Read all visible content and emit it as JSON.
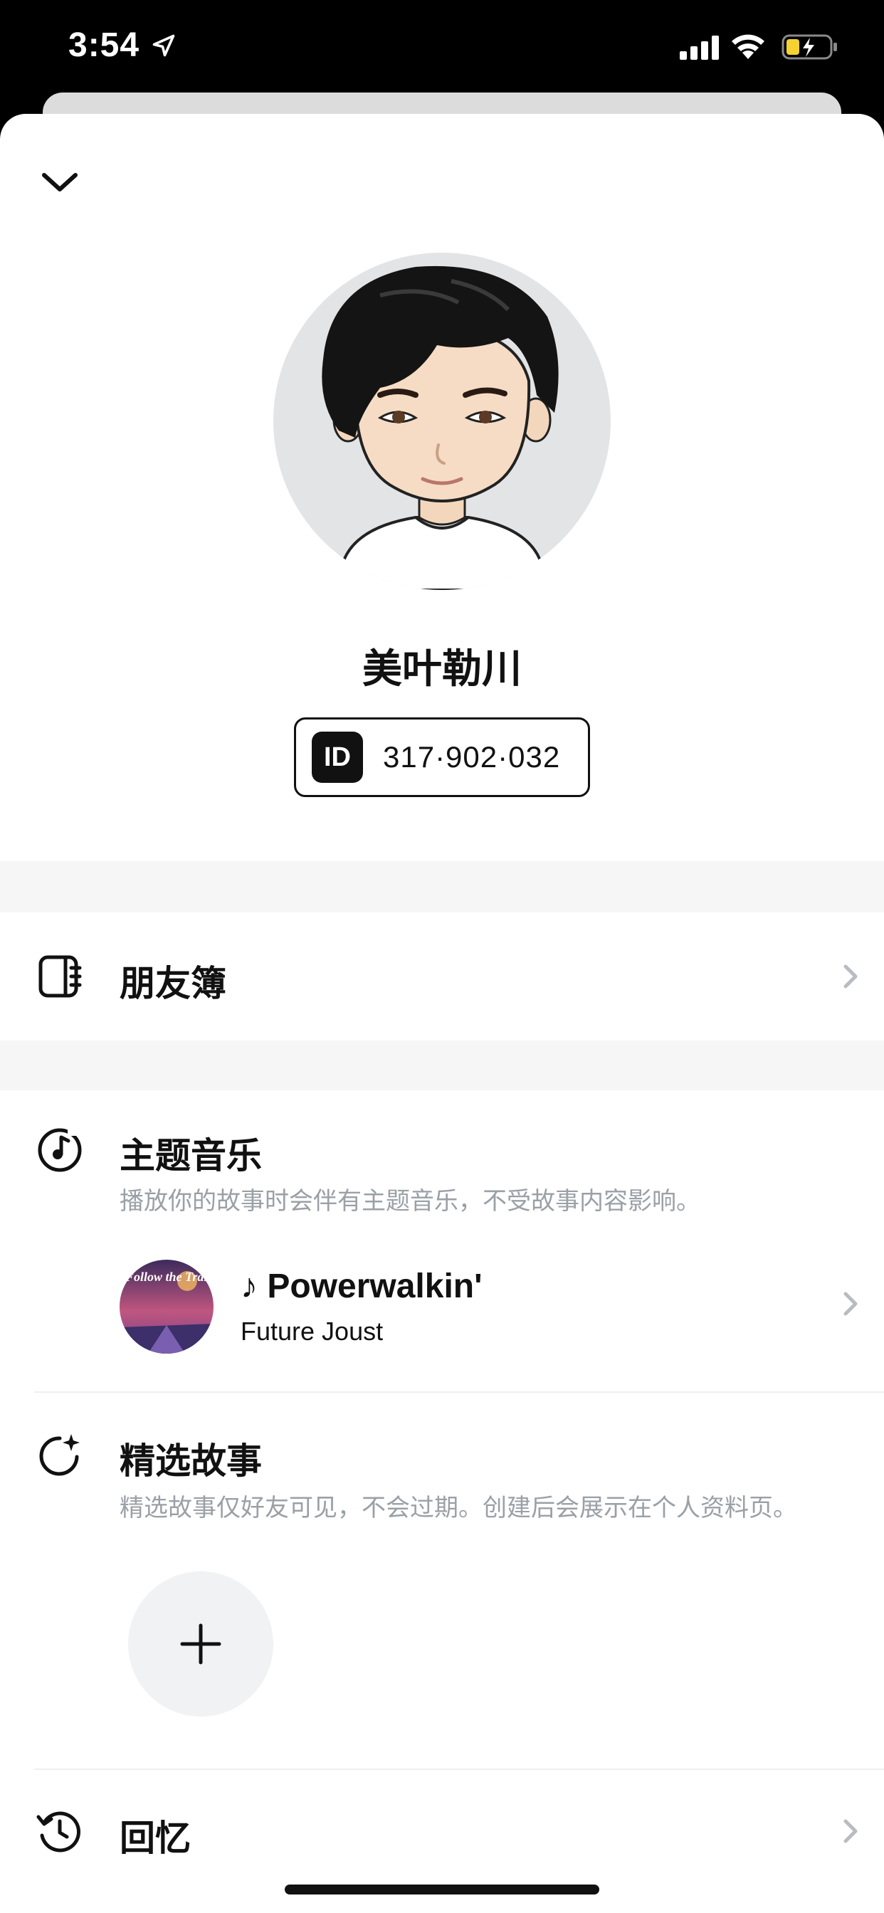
{
  "status_bar": {
    "time": "3:54"
  },
  "profile": {
    "display_name": "美叶勒川",
    "id_chip": "ID",
    "id_number": "317·902·032"
  },
  "sections": {
    "friends": {
      "title": "朋友簿"
    },
    "theme_music": {
      "title": "主题音乐",
      "subtitle": "播放你的故事时会伴有主题音乐，不受故事内容影响。",
      "song": {
        "title": "♪ Powerwalkin'",
        "artist": "Future Joust",
        "cover_text": "Follow the Trail"
      }
    },
    "featured_stories": {
      "title": "精选故事",
      "subtitle": "精选故事仅好友可见，不会过期。创建后会展示在个人资料页。"
    },
    "memories": {
      "title": "回忆"
    }
  },
  "colors": {
    "background": "#ffffff",
    "band": "#f6f6f7",
    "text": "#111111",
    "subtext": "#9aa0a6",
    "avatar_bg": "#e3e4e6"
  },
  "icons": {
    "collapse": "chevron-down-icon",
    "friends": "address-book-icon",
    "theme_music": "music-disc-icon",
    "featured_stories": "sparkle-circle-icon",
    "memories": "history-clock-icon",
    "add": "plus-icon",
    "row_chevron": "chevron-right-icon"
  }
}
